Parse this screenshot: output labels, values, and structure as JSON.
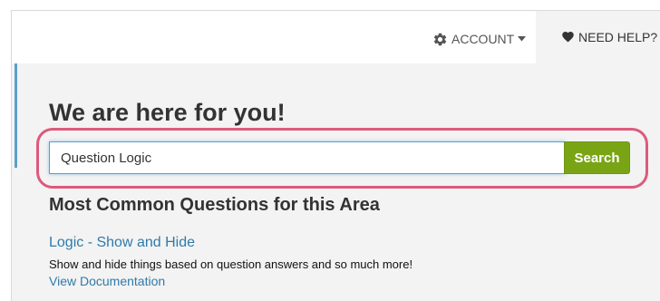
{
  "topbar": {
    "account": {
      "label": "ACCOUNT",
      "icon": "gear-icon",
      "caret_icon": "caret-down-icon"
    },
    "help": {
      "label": "NEED HELP?",
      "icon": "heart-icon"
    }
  },
  "help_panel": {
    "heading": "We are here for you!",
    "search": {
      "value": "Question Logic",
      "button_label": "Search"
    },
    "section_title": "Most Common Questions for this Area",
    "articles": [
      {
        "title": "Logic - Show and Hide",
        "description": "Show and hide things based on question answers and so much more!",
        "doc_link": "View Documentation"
      }
    ]
  },
  "colors": {
    "highlight_ring": "#dd5a7d",
    "search_button": "#79a515",
    "link": "#2f7ba9",
    "panel_background": "#f3f3f3",
    "accent_bar": "#5aa0c8"
  }
}
